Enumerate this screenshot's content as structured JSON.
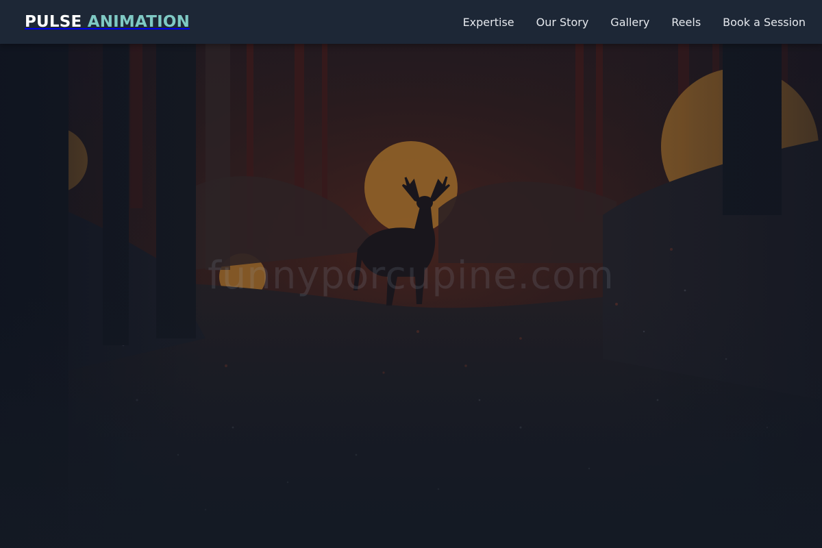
{
  "brand": {
    "part1": "PULSE",
    "part2": "ANIMATION",
    "accent_color": "#7fc9c4"
  },
  "nav": {
    "items": [
      {
        "label": "Expertise"
      },
      {
        "label": "Our Story"
      },
      {
        "label": "Gallery"
      },
      {
        "label": "Reels"
      },
      {
        "label": "Book a Session"
      }
    ]
  },
  "hero": {
    "watermark": "funnyporcupine.com",
    "colors": {
      "overlay": "#141a24",
      "sun": "#d48a2a",
      "forest_red": "#5a1f16"
    }
  }
}
